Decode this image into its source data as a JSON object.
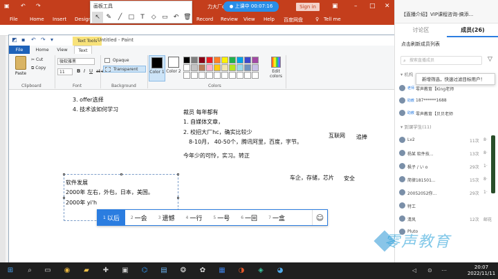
{
  "ppt": {
    "title_fragment": "力大厂offe",
    "signin": "Sign in",
    "tabs": [
      "File",
      "Home",
      "Insert",
      "Design",
      "Record",
      "Review",
      "View",
      "Help",
      "百度网盘",
      "Tell me"
    ]
  },
  "draw_toolbar": {
    "title": "画板工具"
  },
  "timer": {
    "text": "上课中 00:07:16"
  },
  "paint": {
    "title": "Untitled - Paint",
    "context_tab": "Text Tools",
    "tabs": [
      "File",
      "Home",
      "View",
      "Text"
    ],
    "clipboard": {
      "paste": "Paste",
      "cut": "Cut",
      "copy": "Copy",
      "label": "Clipboard"
    },
    "font": {
      "family": "微软雅黑",
      "size": "11",
      "label": "Font"
    },
    "background": {
      "opaque": "Opaque",
      "transparent": "Transparent",
      "label": "Background"
    },
    "colors": {
      "color1": "Color 1",
      "color2": "Color 2",
      "edit": "Edit colors",
      "label": "Colors"
    }
  },
  "canvas": {
    "left_list": [
      "3. offer选择",
      "4. 技术该如何学习"
    ],
    "center_block": [
      "裁员 每年都有",
      "1. 自媒体文章，",
      "2. 校招大厂hc，确实比较少",
      "8-10月， 40-50个，腾讯阿里，百度，字节。",
      "今年少的可怜，实习。转正"
    ],
    "right_words": [
      "互联网",
      "追捧",
      "车企，存储，芯片",
      "安全"
    ],
    "selbox_lines": [
      "软件发展",
      "2000年 左右，外包，日本，美国。",
      "2000年 yi'h"
    ]
  },
  "ime": {
    "candidates": [
      {
        "n": "1",
        "w": "以后"
      },
      {
        "n": "2",
        "w": "一会"
      },
      {
        "n": "3",
        "w": "遗憾"
      },
      {
        "n": "4",
        "w": "一行"
      },
      {
        "n": "5",
        "w": "一号"
      },
      {
        "n": "6",
        "w": "一回"
      },
      {
        "n": "7",
        "w": "一盒"
      }
    ],
    "emoji": "☺"
  },
  "live": {
    "header_title": "【直播介绍】VIP课程咨询-搞添...",
    "tab_discuss": "讨论区",
    "tab_members": "成员(26)",
    "refresh": "点击刷新成员列表",
    "search_placeholder": "搜索直播成员",
    "tooltip": "新增筛选，快速过滤目标用户！",
    "section_org": "机构",
    "section_students": "到课学生(11)",
    "org_members": [
      {
        "tag": "老师",
        "name": "零声教育【King老师"
      },
      {
        "tag": "助教",
        "name": "187******1688"
      },
      {
        "tag": "助教",
        "name": "零声教育【贝贝老师"
      }
    ],
    "students": [
      {
        "name": "Lv2",
        "meta": "11次",
        "meta2": "8·"
      },
      {
        "name": "杨某 软件技...",
        "meta": "13次",
        "meta2": "8·"
      },
      {
        "name": "枫子 / い o",
        "meta": "29次",
        "meta2": "1·"
      },
      {
        "name": "简律181501...",
        "meta": "15次",
        "meta2": "8·"
      },
      {
        "name": "20052052你...",
        "meta": "29次",
        "meta2": "1·"
      },
      {
        "name": "特工",
        "meta": "",
        "meta2": ""
      },
      {
        "name": "清风",
        "meta": "12次",
        "meta2": "邮花"
      },
      {
        "name": "Pluto",
        "meta": "",
        "meta2": ""
      }
    ],
    "watermark": "零声教育"
  },
  "taskbar": {
    "time": "20:07",
    "date": "2022/11/11"
  }
}
